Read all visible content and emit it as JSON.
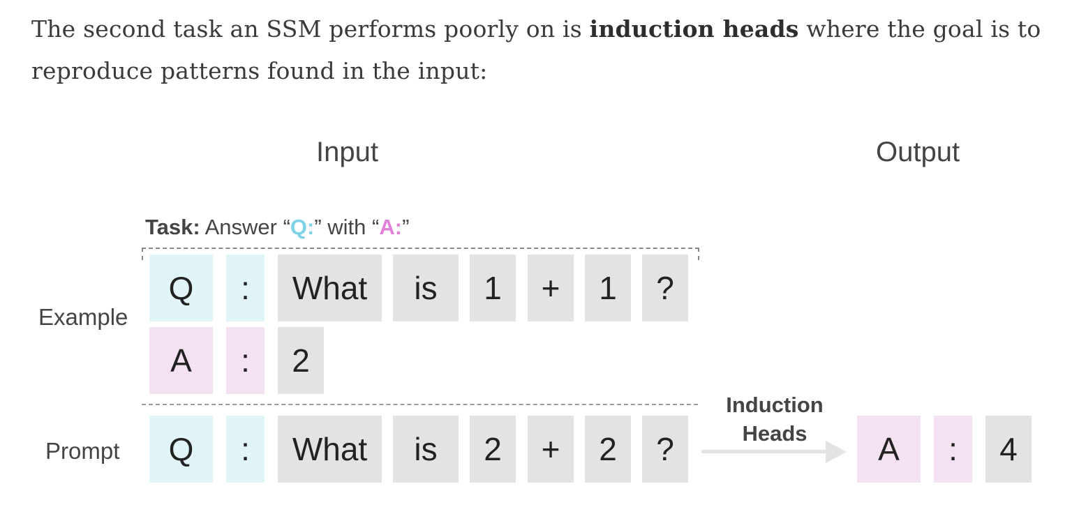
{
  "paragraph": {
    "before": "The second task an SSM performs poorly on is ",
    "bold": "induction heads",
    "after": " where the goal is to reproduce patterns found in the input:"
  },
  "figure": {
    "input_heading": "Input",
    "output_heading": "Output",
    "task": {
      "label": "Task:",
      "pre": " Answer “",
      "q": "Q:",
      "mid": "” with “",
      "a": "A:",
      "post": "”"
    },
    "example_label": "Example",
    "prompt_label": "Prompt",
    "example_q_tokens": [
      "Q",
      ":",
      "What",
      "is",
      "1",
      "+",
      "1",
      "?"
    ],
    "example_a_tokens": [
      "A",
      ":",
      "2"
    ],
    "prompt_tokens": [
      "Q",
      ":",
      "What",
      "is",
      "2",
      "+",
      "2",
      "?"
    ],
    "output_tokens": [
      "A",
      ":",
      "4"
    ],
    "induction_label_line1": "Induction",
    "induction_label_line2": "Heads",
    "colors": {
      "cyan": "#e1f4f8",
      "pink": "#f4e1f2",
      "gray": "#e3e3e3",
      "q_accent": "#7fd3e6",
      "a_accent": "#e27fd8"
    }
  }
}
